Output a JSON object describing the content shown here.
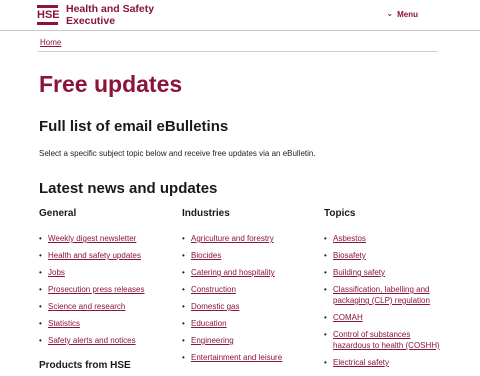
{
  "header": {
    "logo_letters": "HSE",
    "logo_line1": "Health and Safety",
    "logo_line2": "Executive",
    "menu_label": "Menu"
  },
  "breadcrumb": {
    "home": "Home"
  },
  "page": {
    "title": "Free updates",
    "full_list_heading": "Full list of email eBulletins",
    "intro": "Select a specific subject topic below and receive free updates via an eBulletin.",
    "latest_heading": "Latest news and updates"
  },
  "columns": [
    {
      "heading": "General",
      "items": [
        "Weekly digest newsletter",
        "Health and safety updates",
        "Jobs",
        "Prosecution press releases",
        "Science and research",
        "Statistics",
        "Safety alerts and notices"
      ]
    },
    {
      "heading": "Industries",
      "items": [
        "Agriculture and forestry",
        "Biocides",
        "Catering and hospitality",
        "Construction",
        "Domestic gas",
        "Education",
        "Engineering",
        "Entertainment and leisure"
      ]
    },
    {
      "heading": "Topics",
      "items": [
        "Asbestos",
        "Biosafety",
        "Building safety",
        "Classification, labelling and packaging (CLP) regulation",
        "COMAH",
        "Control of substances hazardous to health (COSHH)",
        "Electrical safety"
      ]
    }
  ],
  "products_heading": "Products from HSE",
  "colors": {
    "brand": "#8a1538",
    "text": "#1a1a1a"
  }
}
